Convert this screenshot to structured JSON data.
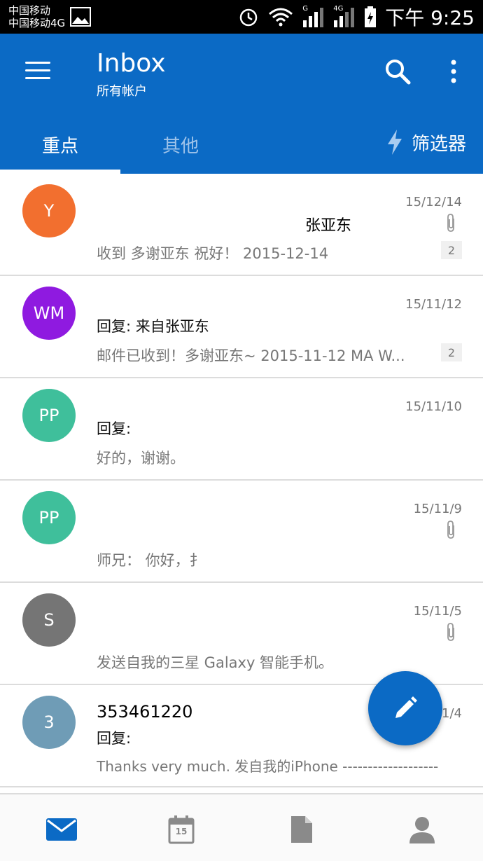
{
  "status_bar": {
    "carrier_1": "中国移动",
    "carrier_2": "中国移动4G",
    "network_label_1": "G",
    "network_label_2": "4G",
    "time": "下午 9:25"
  },
  "header": {
    "title": "Inbox",
    "subtitle": "所有帐户"
  },
  "tabs": {
    "focused": "重点",
    "other": "其他",
    "filter": "筛选器"
  },
  "emails": [
    {
      "avatar_text": "Y",
      "avatar_color": "#f26f2f",
      "date": "15/12/14",
      "sender": "张亚东",
      "subject": "",
      "snippet": "收到 多谢亚东 祝好！ 2015-12-14",
      "thread_count": "2",
      "has_attachment": true
    },
    {
      "avatar_text": "WM",
      "avatar_color": "#8f1ae0",
      "date": "15/11/12",
      "sender": "",
      "subject": "回复: 来自张亚东",
      "snippet": "邮件已收到！多谢亚东~ 2015-11-12 MA W...",
      "thread_count": "2",
      "has_attachment": false
    },
    {
      "avatar_text": "PP",
      "avatar_color": "#3fbf9b",
      "date": "15/11/10",
      "sender": "",
      "subject": "回复:",
      "snippet": "好的，谢谢。",
      "thread_count": "",
      "has_attachment": false
    },
    {
      "avatar_text": "PP",
      "avatar_color": "#3fbf9b",
      "date": "15/11/9",
      "sender": "",
      "subject": "",
      "snippet": "师兄： 你好，扌",
      "thread_count": "",
      "has_attachment": true
    },
    {
      "avatar_text": "S",
      "avatar_color": "#757575",
      "date": "15/11/5",
      "sender": "",
      "subject": "",
      "snippet": "发送自我的三星 Galaxy 智能手机。",
      "thread_count": "",
      "has_attachment": true
    },
    {
      "avatar_text": "3",
      "avatar_color": "#6f9cb6",
      "date": "1/4",
      "sender": "353461220",
      "subject": "回复:",
      "snippet": "Thanks very much. 发自我的iPhone -------------------",
      "thread_count": "",
      "has_attachment": false
    }
  ],
  "bottom_nav": {
    "calendar_day": "15"
  },
  "colors": {
    "primary": "#0b6ac5",
    "tab_inactive": "#9ec3ea",
    "secondary_text": "#777777"
  }
}
